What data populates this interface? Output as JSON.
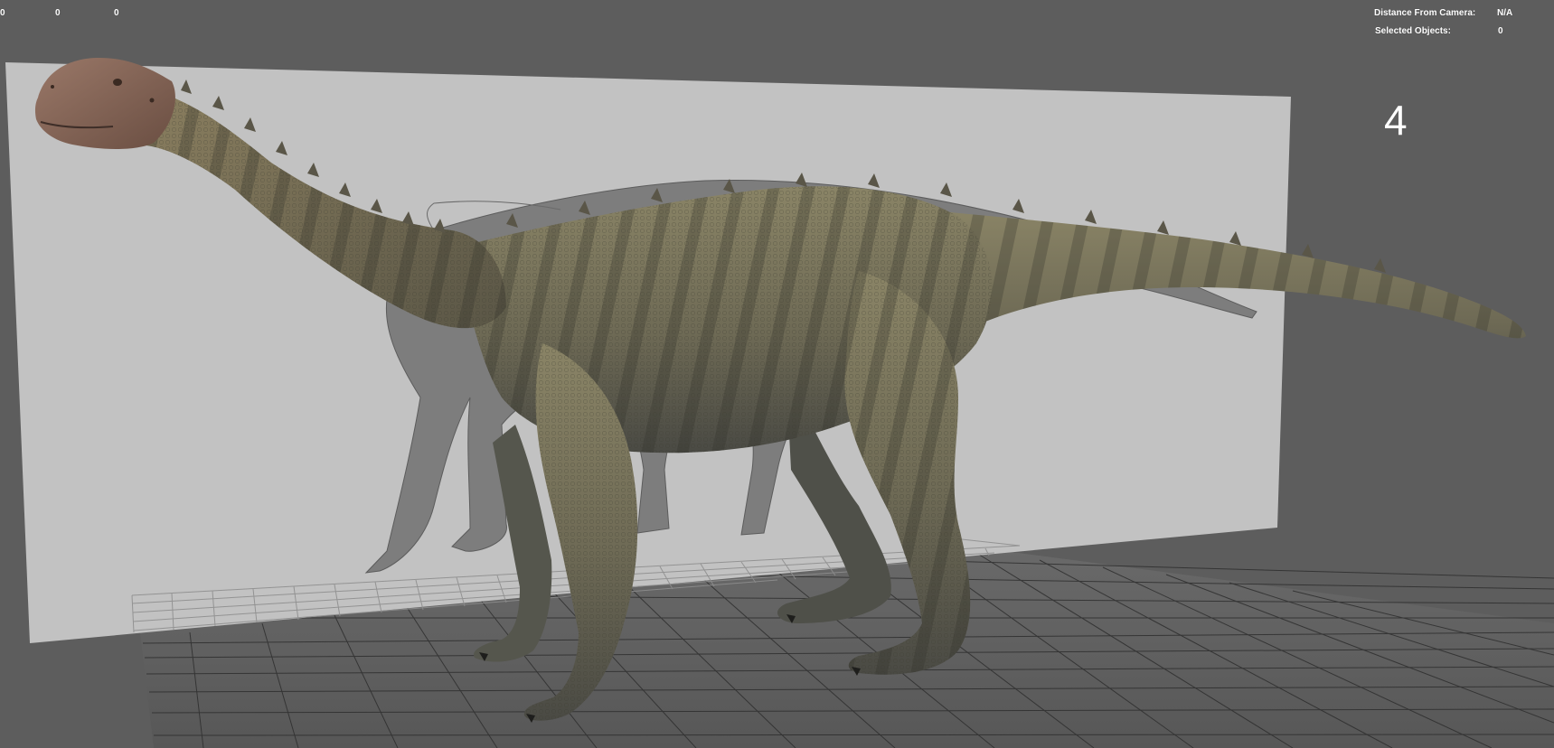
{
  "hud": {
    "left_values": [
      "0",
      "0",
      "0"
    ],
    "distance_label": "Distance From Camera:",
    "distance_value": "N/A",
    "selected_label": "Selected Objects:",
    "selected_value": "0"
  },
  "view": {
    "number": "4"
  },
  "colors": {
    "viewport_background": "#5d5d5d",
    "image_plane": "#c2c2c2",
    "grid_line": "#2e2e2e",
    "hud_text": "#ffffff",
    "dinosaur_body": "#7a7358",
    "dinosaur_dark": "#4c4a40",
    "dinosaur_head": "#7c5e50"
  }
}
